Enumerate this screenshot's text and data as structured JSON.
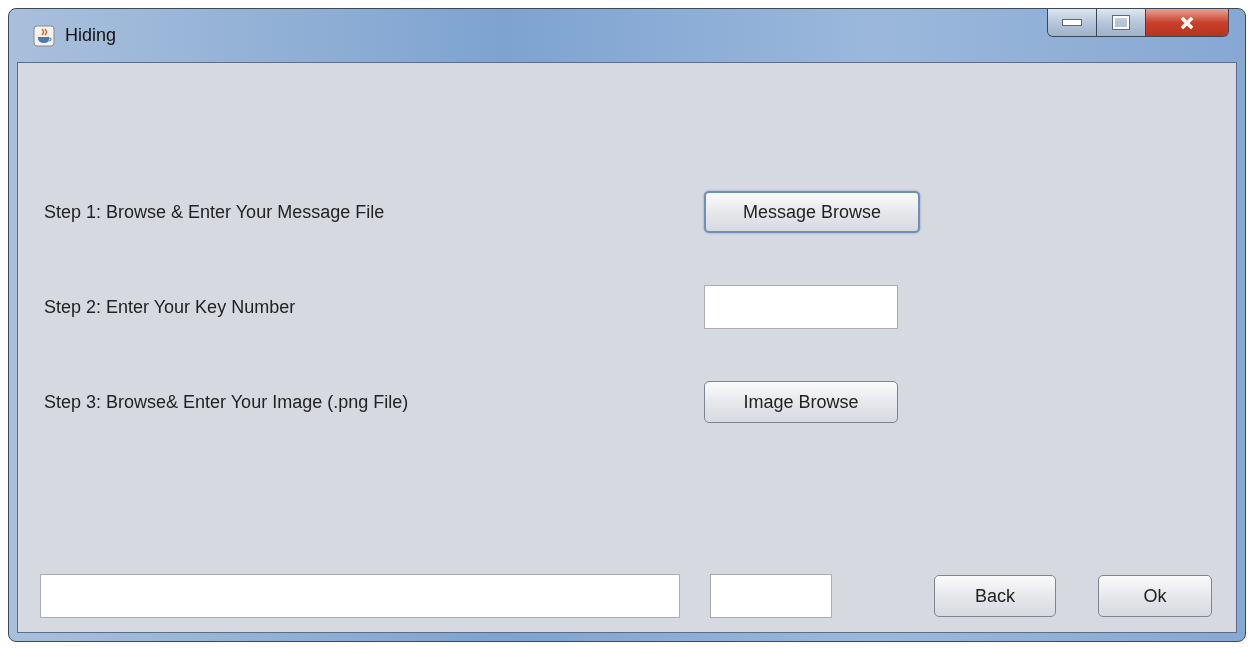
{
  "window": {
    "title": "Hiding"
  },
  "steps": [
    {
      "label": "Step 1: Browse & Enter Your Message File",
      "kind": "button",
      "text": "Message Browse",
      "focused": true
    },
    {
      "label": "Step 2: Enter Your Key Number",
      "kind": "field"
    },
    {
      "label": "Step 3: Browse& Enter Your Image (.png File)",
      "kind": "button",
      "text": "Image Browse",
      "focused": false
    }
  ],
  "footer": {
    "buttons": [
      "Back",
      "Ok"
    ]
  }
}
